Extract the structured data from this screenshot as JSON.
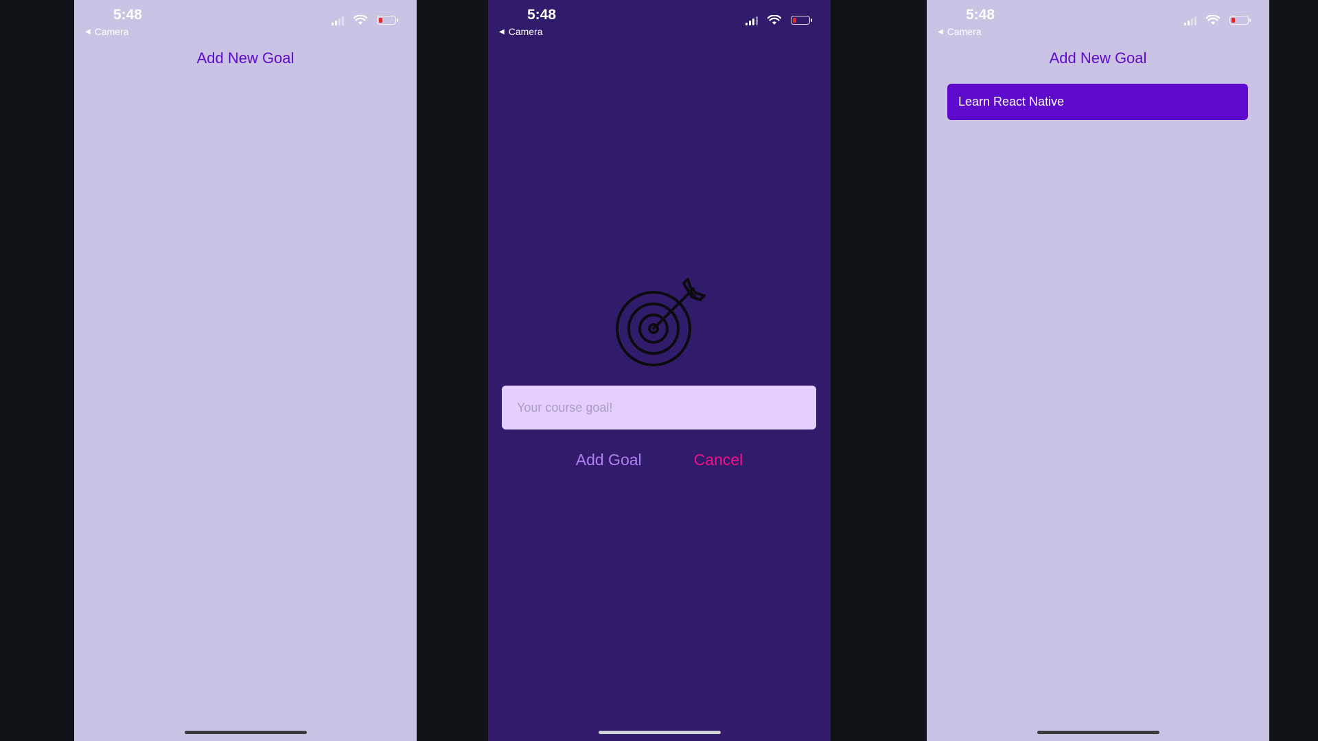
{
  "status": {
    "time": "5:48",
    "back_label": "Camera"
  },
  "screen1": {
    "add_button_label": "Add New Goal"
  },
  "modal": {
    "input_placeholder": "Your course goal!",
    "input_value": "",
    "add_label": "Add Goal",
    "cancel_label": "Cancel",
    "image": "target-arrow-icon"
  },
  "screen3": {
    "add_button_label": "Add New Goal",
    "goals": [
      "Learn React Native"
    ]
  },
  "colors": {
    "light_bg": "#cbc3e3",
    "dark_bg": "#311b6b",
    "accent": "#5e0acc",
    "input_bg": "#e4d0ff",
    "add_text": "#b180f0",
    "cancel_text": "#f31282"
  }
}
